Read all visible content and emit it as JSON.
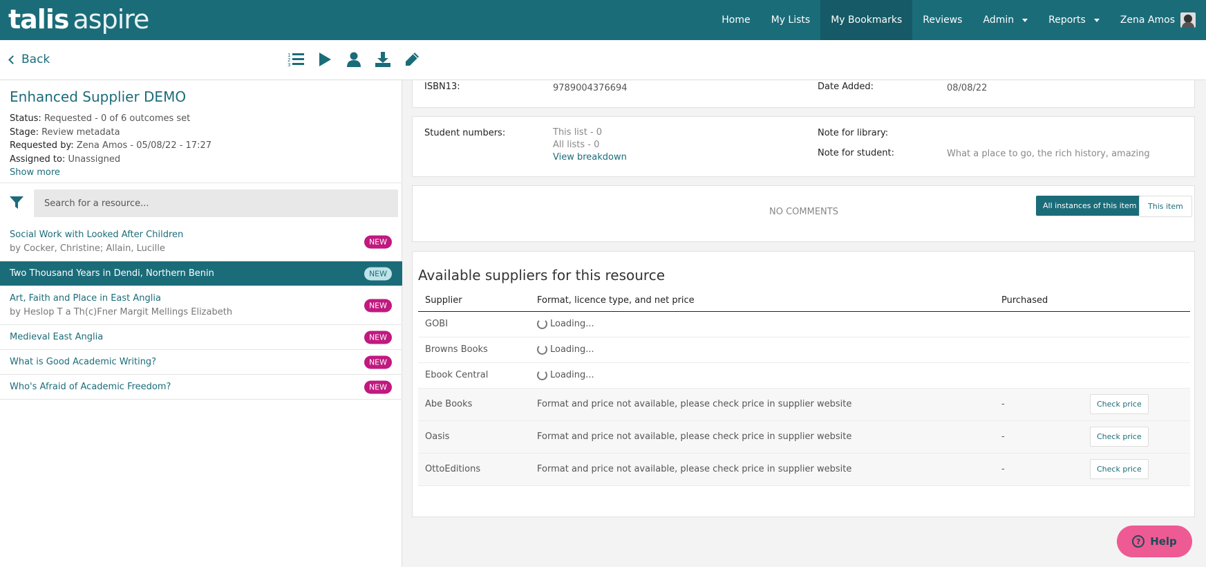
{
  "brand": {
    "part1": "talis",
    "part2": "aspire"
  },
  "nav": {
    "items": [
      "Home",
      "My Lists",
      "My Bookmarks",
      "Reviews",
      "Admin",
      "Reports"
    ],
    "user": "Zena Amos"
  },
  "toolbar": {
    "back": "Back"
  },
  "request": {
    "title": "Enhanced Supplier DEMO",
    "status_label": "Status:",
    "status_value": "Requested - 0 of 6 outcomes set",
    "stage_label": "Stage:",
    "stage_value": "Review metadata",
    "requested_label": "Requested by:",
    "requested_value": "Zena Amos - 05/08/22 - 17:27",
    "assigned_label": "Assigned to:",
    "assigned_value": "Unassigned",
    "show_more": "Show more"
  },
  "search": {
    "placeholder": "Search for a resource..."
  },
  "resources": [
    {
      "title": "Social Work with Looked After Children",
      "by": "by Cocker, Christine; Allain, Lucille",
      "badge": "NEW"
    },
    {
      "title": "Two Thousand Years in Dendi, Northern Benin",
      "by": "",
      "badge": "NEW"
    },
    {
      "title": "Art, Faith and Place in East Anglia",
      "by": "by Heslop T a Th(c)Fner Margit Mellings Elizabeth",
      "badge": "NEW"
    },
    {
      "title": "Medieval East Anglia",
      "by": "",
      "badge": "NEW"
    },
    {
      "title": "What is Good Academic Writing?",
      "by": "",
      "badge": "NEW"
    },
    {
      "title": "Who's Afraid of Academic Freedom?",
      "by": "",
      "badge": "NEW"
    }
  ],
  "details": {
    "isbn_label": "ISBN13:",
    "isbn_value": "9789004376694",
    "date_label": "Date Added:",
    "date_value": "08/08/22",
    "students_label": "Student numbers:",
    "this_list": "This list - 0",
    "all_lists": "All lists - 0",
    "breakdown": "View breakdown",
    "note_library_label": "Note for library:",
    "note_student_label": "Note for student:",
    "note_student_value": "What a place to go, the rich history, amazing"
  },
  "comments": {
    "empty": "NO COMMENTS",
    "all_instances": "All instances of this item",
    "this_item": "This item"
  },
  "suppliers": {
    "title": "Available suppliers for this resource",
    "headers": [
      "Supplier",
      "Format, licence type, and net price",
      "Purchased"
    ],
    "loading_text": "Loading...",
    "loading_rows": [
      "GOBI",
      "Browns Books",
      "Ebook Central"
    ],
    "na_rows": [
      {
        "name": "Abe Books",
        "info": "Format and price not available, please check price in supplier website",
        "purchased": "-",
        "action": "Check price"
      },
      {
        "name": "Oasis",
        "info": "Format and price not available, please check price in supplier website",
        "purchased": "-",
        "action": "Check price"
      },
      {
        "name": "OttoEditions",
        "info": "Format and price not available, please check price in supplier website",
        "purchased": "-",
        "action": "Check price"
      }
    ]
  },
  "help": {
    "label": "Help"
  }
}
